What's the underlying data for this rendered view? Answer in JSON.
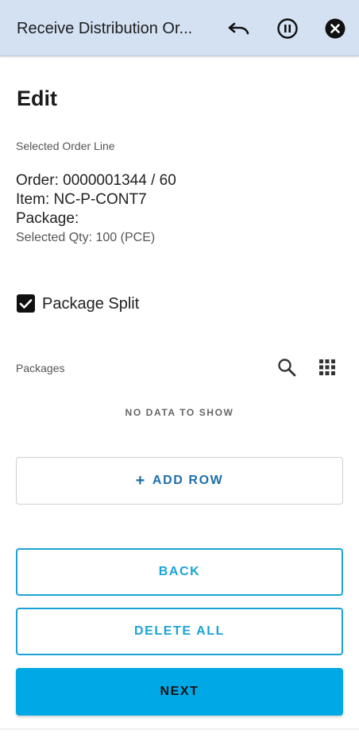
{
  "header": {
    "title": "Receive Distribution Or...",
    "icons": [
      "undo-icon",
      "pause-icon",
      "close-icon"
    ]
  },
  "page": {
    "title": "Edit"
  },
  "order_line": {
    "section_label": "Selected Order Line",
    "order": "Order: 0000001344 / 60",
    "item": "Item: NC-P-CONT7",
    "package": "Package:",
    "qty": "Selected Qty: 100 (PCE)"
  },
  "package_split": {
    "label": "Package Split",
    "checked": true
  },
  "packages": {
    "label": "Packages",
    "empty_text": "NO DATA TO SHOW",
    "icons": [
      "search-icon",
      "grid-icon"
    ]
  },
  "buttons": {
    "add_row": "ADD ROW",
    "back": "BACK",
    "delete_all": "DELETE ALL",
    "next": "NEXT"
  },
  "colors": {
    "header_bg": "#d3e1f3",
    "accent": "#1aa3d6",
    "primary_button": "#00a8e6",
    "add_row_text": "#1d6fa8"
  }
}
